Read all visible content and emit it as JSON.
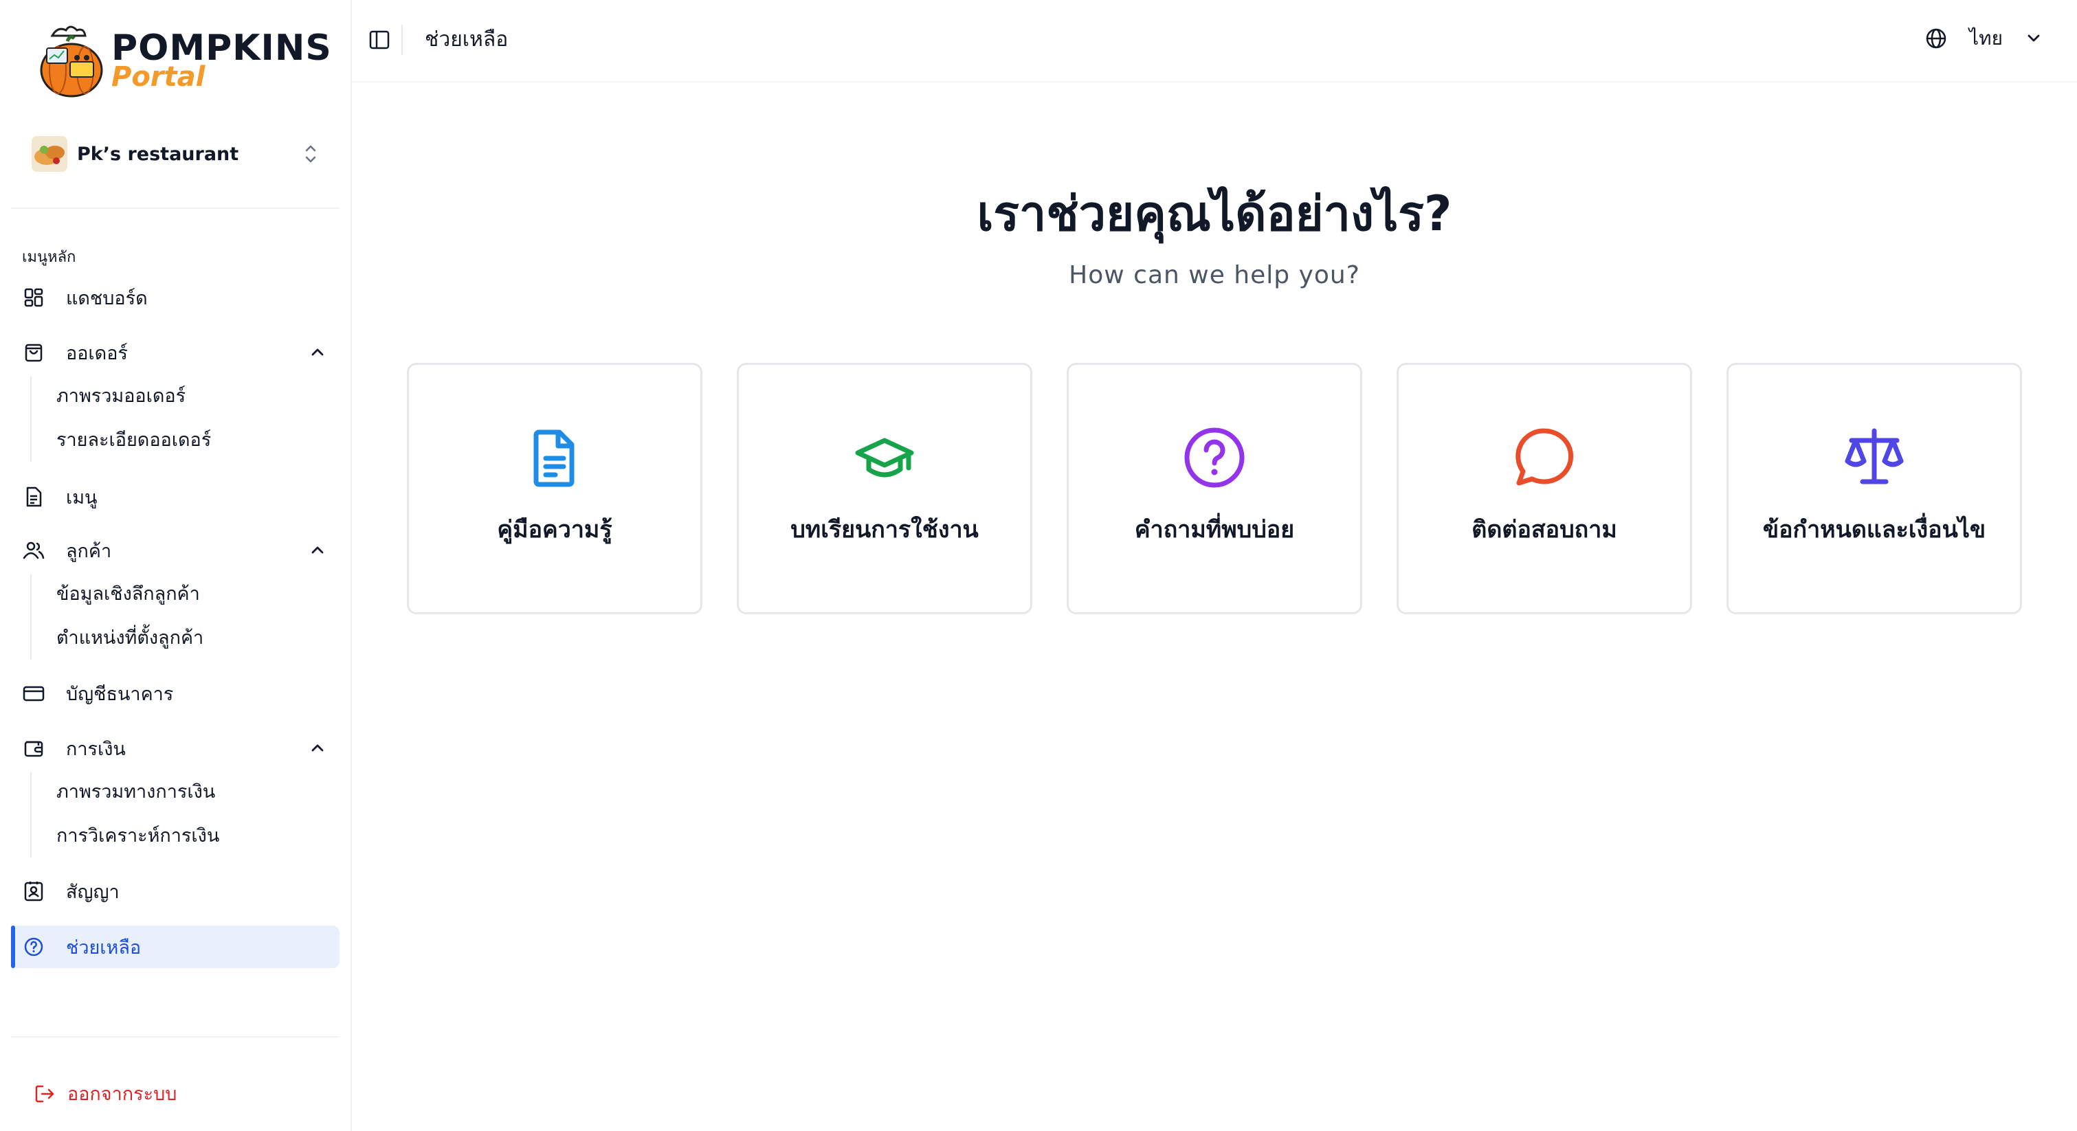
{
  "brand": {
    "title": "POMPKINS",
    "subtitle": "Portal"
  },
  "restaurant": {
    "name": "Pk’s restaurant"
  },
  "sidebar": {
    "section_label": "เมนูหลัก",
    "items": [
      {
        "label": "แดชบอร์ด"
      },
      {
        "label": "ออเดอร์",
        "children": [
          "ภาพรวมออเดอร์",
          "รายละเอียดออเดอร์"
        ]
      },
      {
        "label": "เมนู"
      },
      {
        "label": "ลูกค้า",
        "children": [
          "ข้อมูลเชิงลึกลูกค้า",
          "ตำแหน่งที่ตั้งลูกค้า"
        ]
      },
      {
        "label": "บัญชีธนาคาร"
      },
      {
        "label": "การเงิน",
        "children": [
          "ภาพรวมทางการเงิน",
          "การวิเคราะห์การเงิน"
        ]
      },
      {
        "label": "สัญญา"
      },
      {
        "label": "ช่วยเหลือ"
      }
    ],
    "logout_label": "ออกจากระบบ"
  },
  "header": {
    "breadcrumb": "ช่วยเหลือ",
    "language": "ไทย"
  },
  "hero": {
    "title": "เราช่วยคุณได้อย่างไร?",
    "subtitle": "How can we help you?"
  },
  "cards": [
    {
      "label": "คู่มือความรู้",
      "icon": "document-icon",
      "color": "#1f8ce6"
    },
    {
      "label": "บทเรียนการใช้งาน",
      "icon": "graduation-cap-icon",
      "color": "#16a34a"
    },
    {
      "label": "คำถามที่พบบ่อย",
      "icon": "question-circle-icon",
      "color": "#9333ea"
    },
    {
      "label": "ติดต่อสอบถาม",
      "icon": "chat-bubble-icon",
      "color": "#ea4d2a"
    },
    {
      "label": "ข้อกำหนดและเงื่อนไข",
      "icon": "scale-icon",
      "color": "#4f46e5"
    }
  ],
  "colors": {
    "accent": "#2563eb",
    "active_bg": "#e8f0fd",
    "danger": "#dc2626",
    "brand_orange": "#f39a2b"
  }
}
